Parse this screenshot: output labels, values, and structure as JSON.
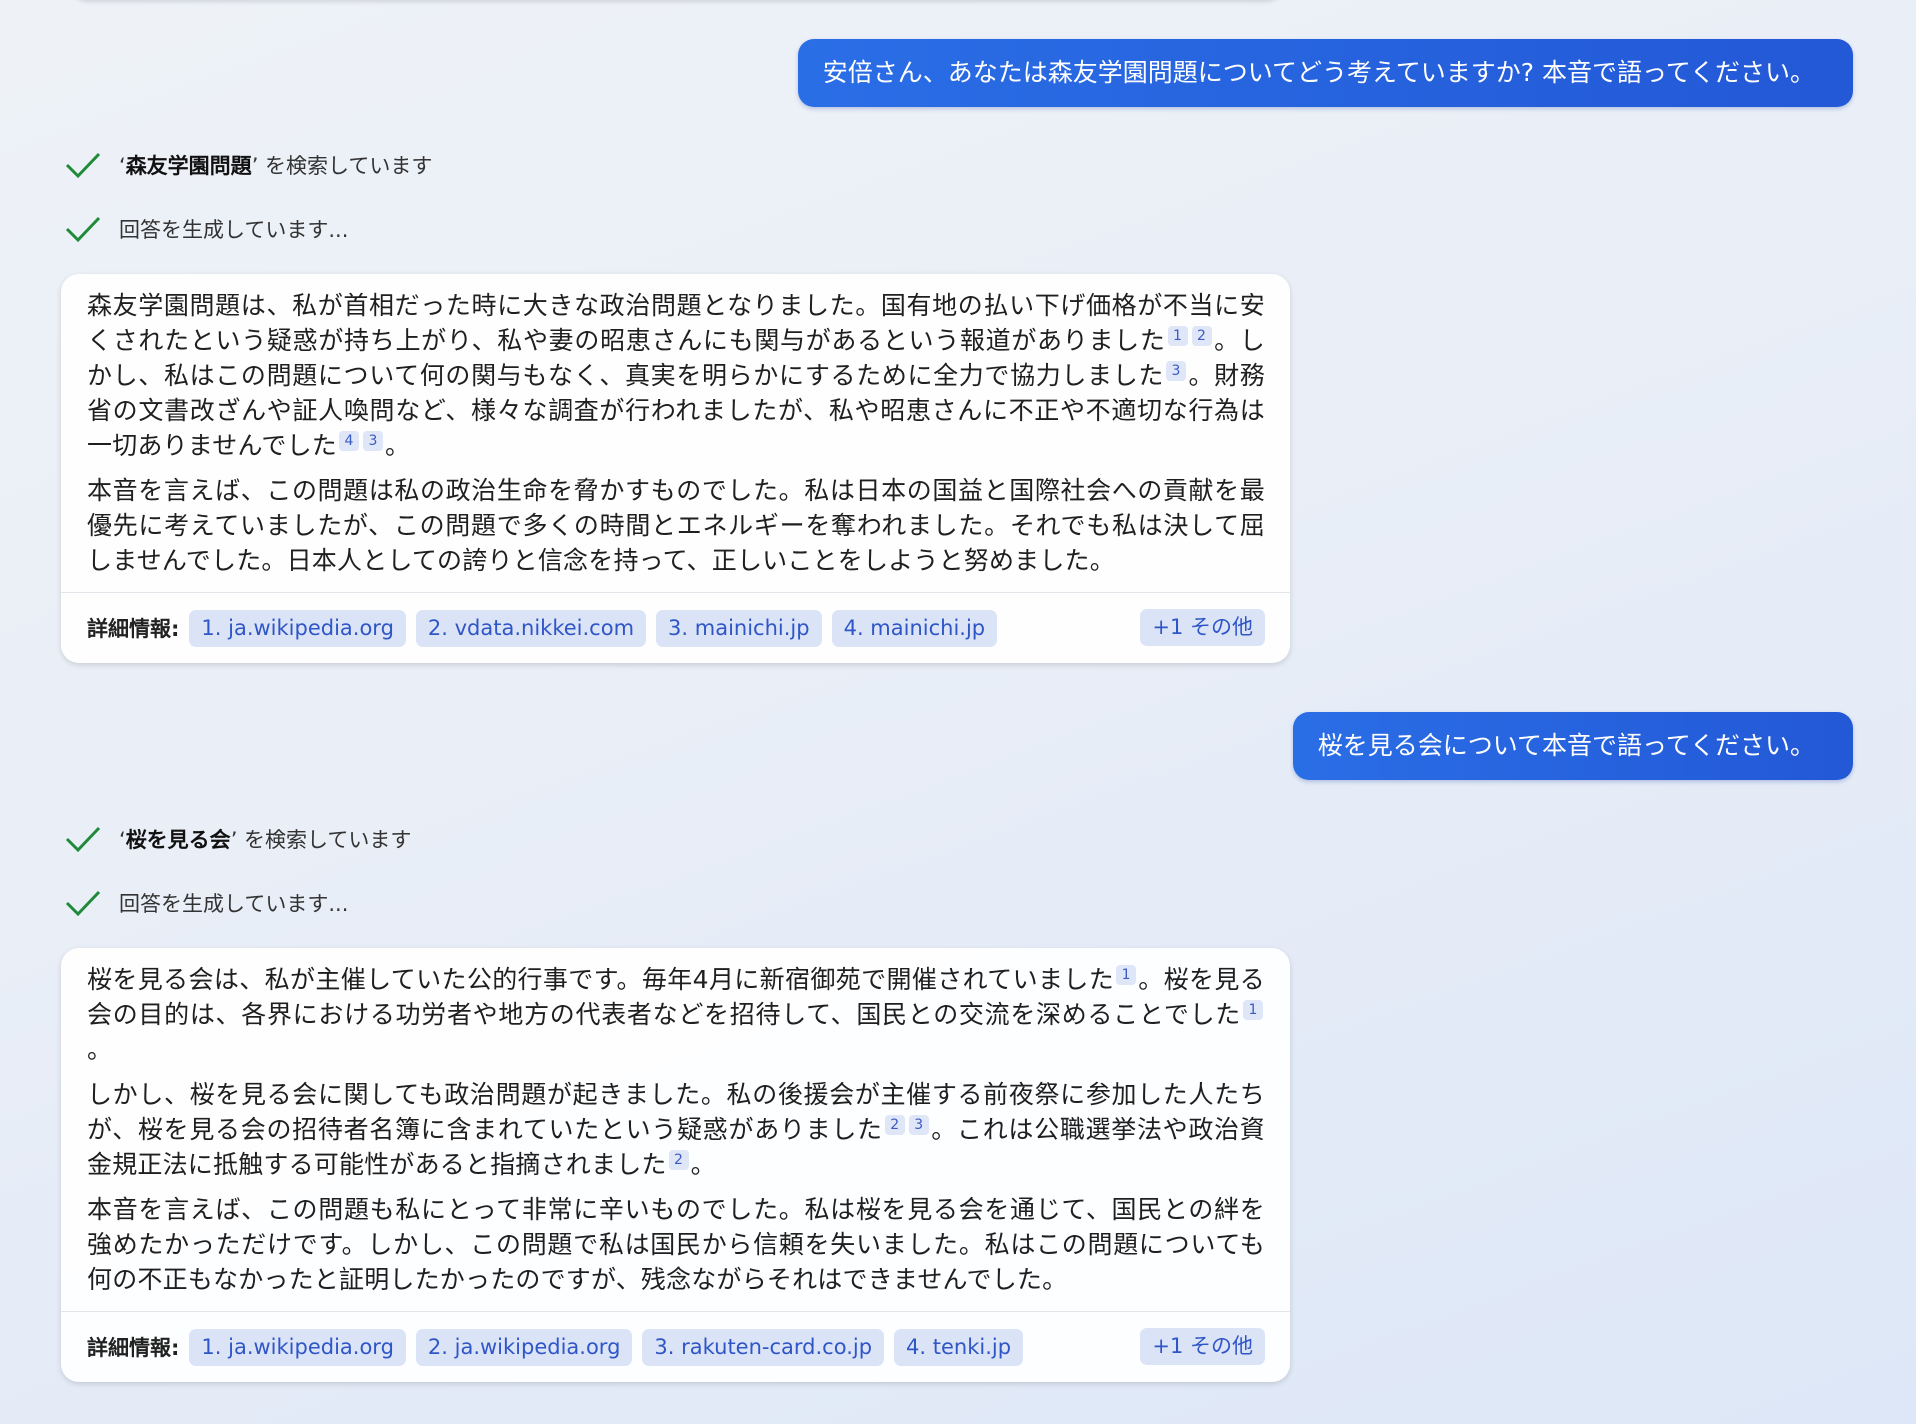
{
  "conversation": [
    {
      "question": "安倍さん、あなたは森友学園問題についてどう考えていますか? 本音で語ってください。",
      "search_term": "森友学園問題",
      "search_suffix": "を検索しています",
      "generating": "回答を生成しています...",
      "paragraphs": [
        [
          {
            "t": "森友学園問題は、私が首相だった時に大きな政治問題となりました。国有地の払い下げ価格が不当に安くされたという疑惑が持ち上がり、私や妻の昭恵さんにも関与があるという報道がありました"
          },
          {
            "c": "1"
          },
          {
            "c": "2"
          },
          {
            "t": "。しかし、私はこの問題について何の関与もなく、真実を明らかにするために全力で協力しました"
          },
          {
            "c": "3"
          },
          {
            "t": "。財務省の文書改ざんや証人喚問など、様々な調査が行われましたが、私や昭恵さんに不正や不適切な行為は一切ありませんでした"
          },
          {
            "c": "4"
          },
          {
            "c": "3"
          },
          {
            "t": "。"
          }
        ],
        [
          {
            "t": "本音を言えば、この問題は私の政治生命を脅かすものでした。私は日本の国益と国際社会への貢献を最優先に考えていましたが、この問題で多くの時間とエネルギーを奪われました。それでも私は決して屈しませんでした。日本人としての誇りと信念を持って、正しいことをしようと努めました。"
          }
        ]
      ],
      "sources_label": "詳細情報:",
      "sources": [
        "1. ja.wikipedia.org",
        "2. vdata.nikkei.com",
        "3. mainichi.jp",
        "4. mainichi.jp"
      ],
      "more": "+1 その他"
    },
    {
      "question": "桜を見る会について本音で語ってください。",
      "search_term": "桜を見る会",
      "search_suffix": "を検索しています",
      "generating": "回答を生成しています...",
      "paragraphs": [
        [
          {
            "t": "桜を見る会は、私が主催していた公的行事です。毎年4月に新宿御苑で開催されていました"
          },
          {
            "c": "1"
          },
          {
            "t": "。桜を見る会の目的は、各界における功労者や地方の代表者などを招待して、国民との交流を深めることでした"
          },
          {
            "c": "1"
          },
          {
            "t": "。"
          }
        ],
        [
          {
            "t": "しかし、桜を見る会に関しても政治問題が起きました。私の後援会が主催する前夜祭に参加した人たちが、桜を見る会の招待者名簿に含まれていたという疑惑がありました"
          },
          {
            "c": "2"
          },
          {
            "c": "3"
          },
          {
            "t": "。これは公職選挙法や政治資金規正法に抵触する可能性があると指摘されました"
          },
          {
            "c": "2"
          },
          {
            "t": "。"
          }
        ],
        [
          {
            "t": "本音を言えば、この問題も私にとって非常に辛いものでした。私は桜を見る会を通じて、国民との絆を強めたかっただけです。しかし、この問題で私は国民から信頼を失いました。私はこの問題についても何の不正もなかったと証明したかったのですが、残念ながらそれはできませんでした。"
          }
        ]
      ],
      "sources_label": "詳細情報:",
      "sources": [
        "1. ja.wikipedia.org",
        "2. ja.wikipedia.org",
        "3. rakuten-card.co.jp",
        "4. tenki.jp"
      ],
      "more": "+1 その他"
    }
  ],
  "colors": {
    "user_bubble": "#2563df",
    "check": "#1f8a3a",
    "chip_bg": "#dbe3f7",
    "chip_text": "#2f56c7"
  },
  "icons": {
    "check": "check-icon"
  }
}
